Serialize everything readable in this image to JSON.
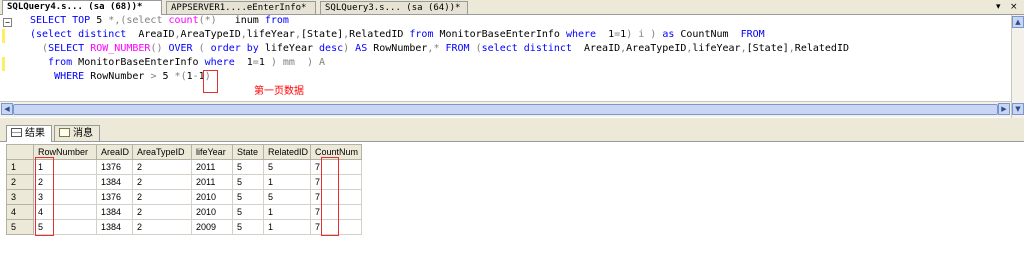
{
  "tabs": [
    {
      "label": "SQLQuery4.s... (sa (68))*",
      "active": true
    },
    {
      "label": "APPSERVER1....eEnterInfo*",
      "active": false
    },
    {
      "label": "SQLQuery3.s... (sa (64))*",
      "active": false
    }
  ],
  "tab_controls": {
    "dropdown": "▾",
    "close": "×"
  },
  "query": {
    "l1": {
      "a": "SELECT TOP ",
      "b": "5 ",
      "c": "*",
      "d": ",(select ",
      "e": "count",
      "f": "(*)",
      "g": "   inum ",
      "h": "from"
    },
    "l2": {
      "a": "(select distinct  ",
      "b": "AreaID",
      "c": ",",
      "d": "AreaTypeID",
      "e": ",",
      "f": "lifeYear",
      "g": ",",
      "h": "[State]",
      "i": ",",
      "j": "RelatedID ",
      "k": "from ",
      "l": "MonitorBaseEnterInfo ",
      "m": "where  ",
      "n": "1",
      "o": "=",
      "p": "1",
      "q": ") i ) ",
      "r": "as ",
      "s": "CountNum  ",
      "t": "FROM"
    },
    "l3": {
      "a": "  (",
      "b": "SELECT ",
      "c": "ROW_NUMBER",
      "d": "() ",
      "e": "OVER ",
      "f": "( ",
      "g": "order by ",
      "h": "lifeYear ",
      "i": "desc",
      "j": ") ",
      "k": "AS ",
      "l": "RowNumber",
      "m": ",",
      "n": "* ",
      "o": "FROM ",
      "p": "(",
      "q": "select distinct  ",
      "r": "AreaID",
      "s": ",",
      "t": "AreaTypeID",
      "u": ",",
      "v": "lifeYear",
      "w": ",",
      "x": "[State]",
      "y": ",",
      "z": "RelatedID"
    },
    "l4": {
      "a": "   from ",
      "b": "MonitorBaseEnterInfo ",
      "c": "where  ",
      "d": "1",
      "e": "=",
      "f": "1 ",
      "g": ") mm  ",
      "h": ") A"
    },
    "l5": {
      "a": "    WHERE ",
      "b": "RowNumber ",
      "c": "> ",
      "d": "5 ",
      "e": "*",
      "f": "(",
      "g": "1",
      "h": "-",
      "i": "1",
      "j": ")"
    }
  },
  "annotation": "第一页数据",
  "result_tabs": [
    {
      "label": "结果",
      "icon": "grid-icon",
      "active": true
    },
    {
      "label": "消息",
      "icon": "message-icon",
      "active": false
    }
  ],
  "grid": {
    "columns": [
      "RowNumber",
      "AreaID",
      "AreaTypeID",
      "lifeYear",
      "State",
      "RelatedID",
      "CountNum"
    ],
    "rows": [
      {
        "n": "1",
        "c": [
          "1",
          "1376",
          "2",
          "2011",
          "5",
          "5",
          "7"
        ]
      },
      {
        "n": "2",
        "c": [
          "2",
          "1384",
          "2",
          "2011",
          "5",
          "1",
          "7"
        ]
      },
      {
        "n": "3",
        "c": [
          "3",
          "1376",
          "2",
          "2010",
          "5",
          "5",
          "7"
        ]
      },
      {
        "n": "4",
        "c": [
          "4",
          "1384",
          "2",
          "2010",
          "5",
          "1",
          "7"
        ]
      },
      {
        "n": "5",
        "c": [
          "5",
          "1384",
          "2",
          "2009",
          "5",
          "1",
          "7"
        ]
      }
    ]
  },
  "colors": {
    "keyword": "#0000ff",
    "function": "#ff00ff",
    "string": "#ff0000",
    "operator": "#808080",
    "highlight_box": "#e53030"
  }
}
